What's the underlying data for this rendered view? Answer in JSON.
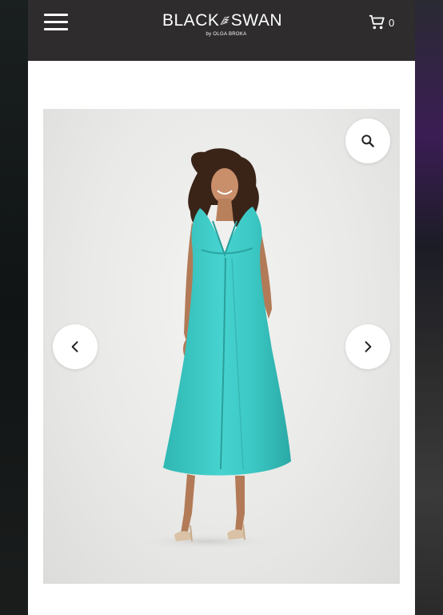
{
  "header": {
    "logo_main_left": "BLACK",
    "logo_main_right": "SWAN",
    "logo_sub": "by OLGA BROKA",
    "cart_count": "0"
  },
  "icons": {
    "menu": "hamburger-menu-icon",
    "cart": "cart-icon",
    "zoom": "search-icon",
    "prev": "chevron-left-icon",
    "next": "chevron-right-icon"
  },
  "product_image": {
    "dress_color": "#3cc8c4",
    "background_color": "#ebebe9"
  },
  "colors": {
    "header_bg": "#2e2c2c",
    "page_bg": "#ffffff"
  }
}
